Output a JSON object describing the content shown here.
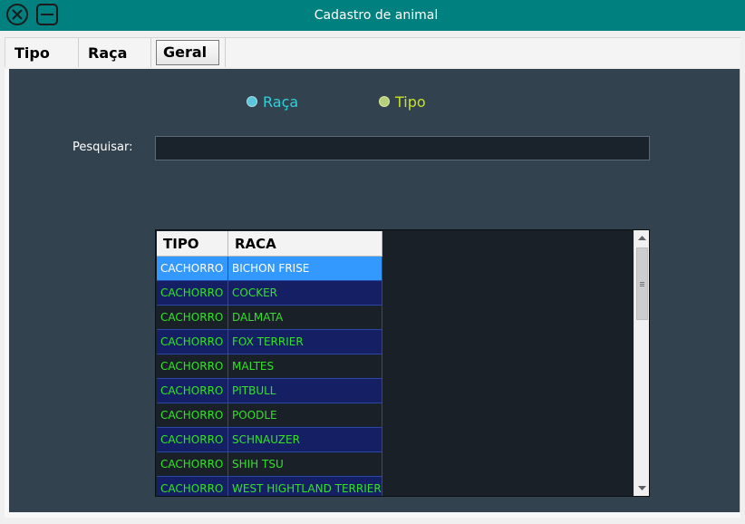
{
  "window": {
    "title": "Cadastro de animal"
  },
  "tabs": [
    {
      "label": "Tipo"
    },
    {
      "label": "Raça"
    },
    {
      "label": "Geral",
      "selected": true
    }
  ],
  "filters": {
    "raca_label": "Raça",
    "tipo_label": "Tipo"
  },
  "search": {
    "label": "Pesquisar:",
    "value": ""
  },
  "grid": {
    "columns": [
      "TIPO",
      "RACA"
    ],
    "rows": [
      {
        "tipo": "CACHORRO",
        "raca": "BICHON FRISE"
      },
      {
        "tipo": "CACHORRO",
        "raca": "COCKER"
      },
      {
        "tipo": "CACHORRO",
        "raca": "DALMATA"
      },
      {
        "tipo": "CACHORRO",
        "raca": "FOX TERRIER"
      },
      {
        "tipo": "CACHORRO",
        "raca": "MALTES"
      },
      {
        "tipo": "CACHORRO",
        "raca": "PITBULL"
      },
      {
        "tipo": "CACHORRO",
        "raca": "POODLE"
      },
      {
        "tipo": "CACHORRO",
        "raca": "SCHNAUZER"
      },
      {
        "tipo": "CACHORRO",
        "raca": "SHIH TSU"
      },
      {
        "tipo": "CACHORRO",
        "raca": "WEST HIGHTLAND TERRIER"
      }
    ],
    "selected_row": 0
  },
  "colors": {
    "titlebar": "#00807f",
    "panel": "#33424f",
    "grid_text": "#35e02a",
    "selection": "#3399ff",
    "row_alt": "#142063"
  },
  "icons": {
    "close": "close-circle-icon",
    "minimize": "minimize-square-icon"
  }
}
